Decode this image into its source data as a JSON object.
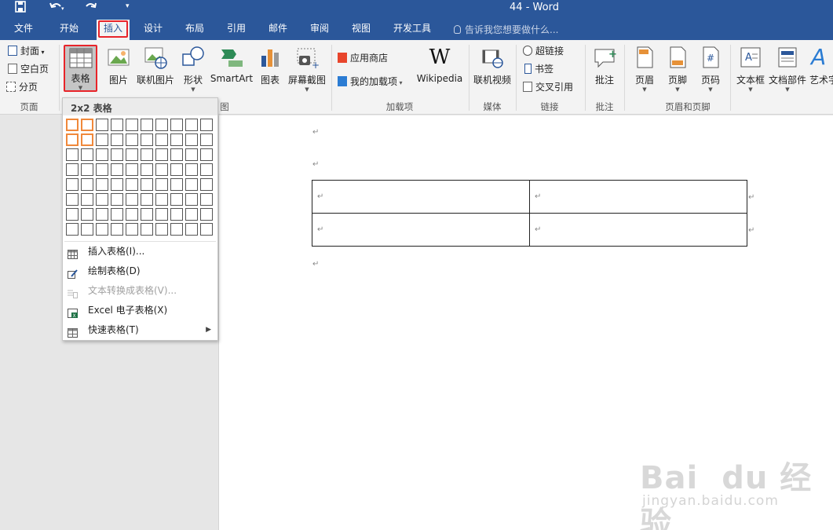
{
  "window": {
    "title": "44 - Word"
  },
  "tabs": [
    {
      "label": "文件"
    },
    {
      "label": "开始"
    },
    {
      "label": "插入"
    },
    {
      "label": "设计"
    },
    {
      "label": "布局"
    },
    {
      "label": "引用"
    },
    {
      "label": "邮件"
    },
    {
      "label": "审阅"
    },
    {
      "label": "视图"
    },
    {
      "label": "开发工具"
    }
  ],
  "tell_me": "告诉我您想要做什么...",
  "ribbon": {
    "pages": {
      "cover": "封面",
      "blank": "空白页",
      "break": "分页",
      "group": "页面"
    },
    "table": {
      "label": "表格"
    },
    "illustrations": {
      "picture": "图片",
      "online_picture": "联机图片",
      "shapes": "形状",
      "smartart": "SmartArt",
      "chart": "图表",
      "screenshot": "屏幕截图",
      "group": "图"
    },
    "addins": {
      "store": "应用商店",
      "my_addins": "我的加载项",
      "wikipedia": "Wikipedia",
      "group": "加载项"
    },
    "media": {
      "online_video": "联机视频",
      "group": "媒体"
    },
    "links": {
      "hyperlink": "超链接",
      "bookmark": "书签",
      "cross_ref": "交叉引用",
      "group": "链接"
    },
    "comments": {
      "comment": "批注",
      "group": "批注"
    },
    "header_footer": {
      "header": "页眉",
      "footer": "页脚",
      "page_number": "页码",
      "group": "页眉和页脚"
    },
    "text": {
      "textbox": "文本框",
      "parts": "文档部件",
      "wordart": "艺术字"
    }
  },
  "dropdown": {
    "header": "2x2 表格",
    "grid": {
      "cols": 10,
      "rows": 8,
      "selected_cols": 2,
      "selected_rows": 2
    },
    "items": [
      {
        "label": "插入表格(I)...",
        "enabled": true
      },
      {
        "label": "绘制表格(D)",
        "enabled": true
      },
      {
        "label": "文本转换成表格(V)...",
        "enabled": false
      },
      {
        "label": "Excel 电子表格(X)",
        "enabled": true
      },
      {
        "label": "快速表格(T)",
        "enabled": true
      }
    ]
  },
  "document": {
    "para_mark": "↵",
    "table": {
      "rows": 2,
      "cols": 2
    }
  },
  "watermark": {
    "main": "Bai du 经验",
    "sub": "jingyan.baidu.com"
  }
}
